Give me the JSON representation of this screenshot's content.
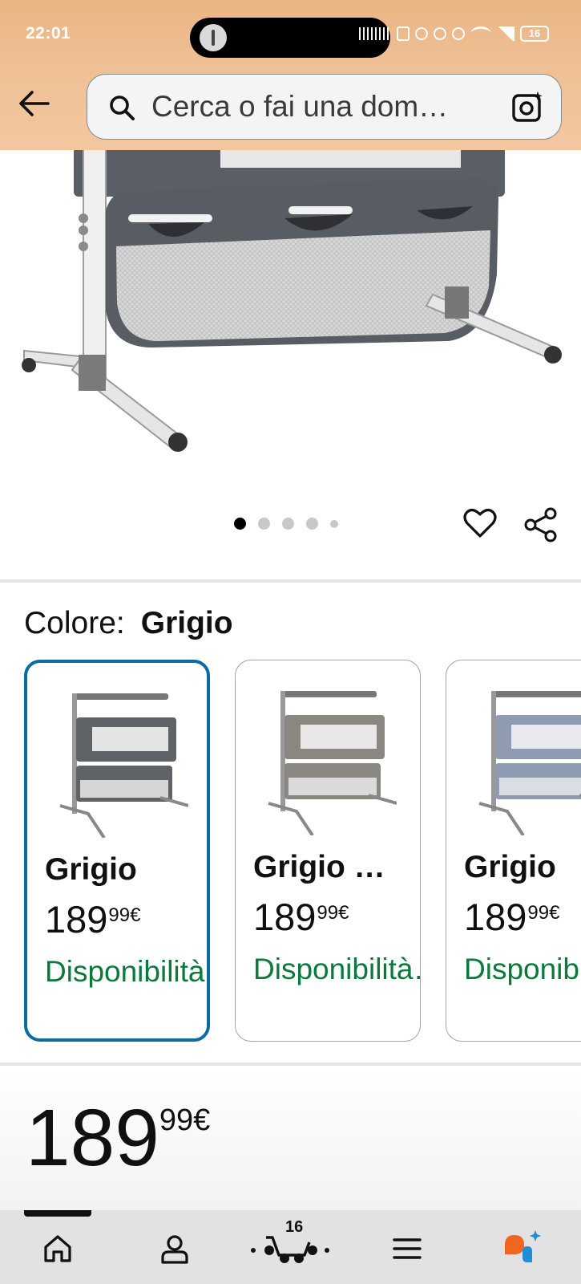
{
  "status_bar": {
    "time": "22:01",
    "battery": "16"
  },
  "search": {
    "placeholder": "Cerca o fai una dom…"
  },
  "gallery": {
    "image_count": 5,
    "active_index": 0
  },
  "color_section": {
    "label": "Colore:",
    "selected_value": "Grigio",
    "options": [
      {
        "name": "Grigio",
        "price_whole": "189",
        "price_fraction": "99",
        "currency": "€",
        "availability": "Disponibilità…",
        "swatch": "#5f6368",
        "selected": true
      },
      {
        "name": "Grigio …",
        "price_whole": "189",
        "price_fraction": "99",
        "currency": "€",
        "availability": "Disponibilità…",
        "swatch": "#8a8780",
        "selected": false
      },
      {
        "name": "Grigio",
        "price_whole": "189",
        "price_fraction": "99",
        "currency": "€",
        "availability": "Disponibilità…",
        "swatch": "#8e9bb0",
        "selected": false
      }
    ]
  },
  "price": {
    "whole": "189",
    "fraction": "99",
    "currency": "€"
  },
  "bottom_nav": {
    "cart_count": "16",
    "items": [
      "home-icon",
      "account-icon",
      "cart-icon",
      "menu-icon",
      "rufus-icon"
    ]
  },
  "colors": {
    "header_bg": "#efc096",
    "selected_border": "#0a6aa3",
    "availability_green": "#0a7a3c",
    "rufus_orange": "#f0651f",
    "rufus_blue": "#1f8ed6"
  }
}
